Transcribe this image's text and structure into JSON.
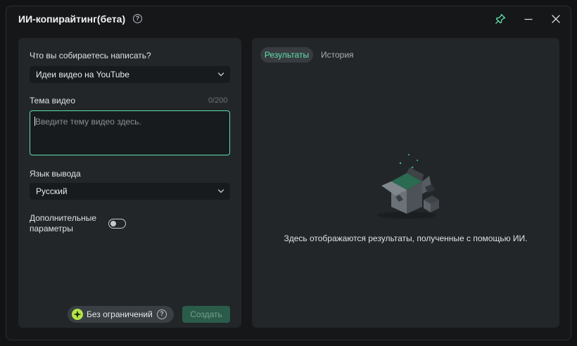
{
  "window": {
    "title": "ИИ-копирайтинг(бета)",
    "help_icon": "?"
  },
  "titlebar": {
    "pin_icon": "pin-icon",
    "minimize_icon": "minimize-icon",
    "close_icon": "close-icon"
  },
  "form": {
    "write_label": "Что вы собираетесь написать?",
    "write_value": "Идеи видео на YouTube",
    "topic_label": "Тема видео",
    "topic_counter": "0/200",
    "topic_placeholder": "Введите тему видео здесь.",
    "language_label": "Язык вывода",
    "language_value": "Русский",
    "advanced_label": "Дополнительные параметры",
    "advanced_enabled": false,
    "plan_label": "Без ограничений",
    "plan_help": "?",
    "create_label": "Создать"
  },
  "results": {
    "tabs": [
      {
        "label": "Результаты",
        "active": true
      },
      {
        "label": "История",
        "active": false
      }
    ],
    "empty_message": "Здесь отображаются результаты, полученные с помощью ИИ."
  },
  "colors": {
    "accent": "#5ce0a8",
    "panel": "#222629",
    "background": "#151719",
    "create_button": "#2a5c49",
    "plan_star": "#b5e645"
  }
}
